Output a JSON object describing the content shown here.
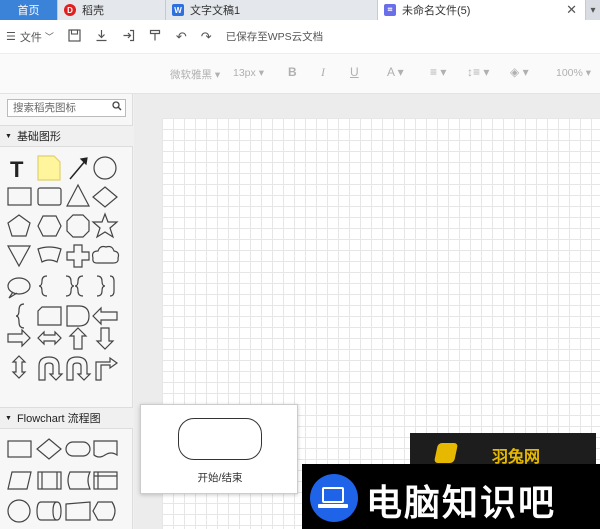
{
  "tabs": {
    "home": "首页",
    "shell": "稻壳",
    "doc": "文字文稿1",
    "active": "未命名文件(5)"
  },
  "toolbar": {
    "file_menu": "文件",
    "saved_status": "已保存至WPS云文档"
  },
  "format_bar": {
    "font": "微软雅黑",
    "size": "13px",
    "bold": "B",
    "italic": "I",
    "underline": "U",
    "font_color": "A",
    "zoom": "100%"
  },
  "sidebar": {
    "search_placeholder": "搜索稻壳图标",
    "section_basic": "基础图形",
    "section_flow": "Flowchart 流程图"
  },
  "tooltip": {
    "label": "开始/结束"
  },
  "watermarks": {
    "brand": "羽兔网",
    "site": "电脑知识吧"
  }
}
